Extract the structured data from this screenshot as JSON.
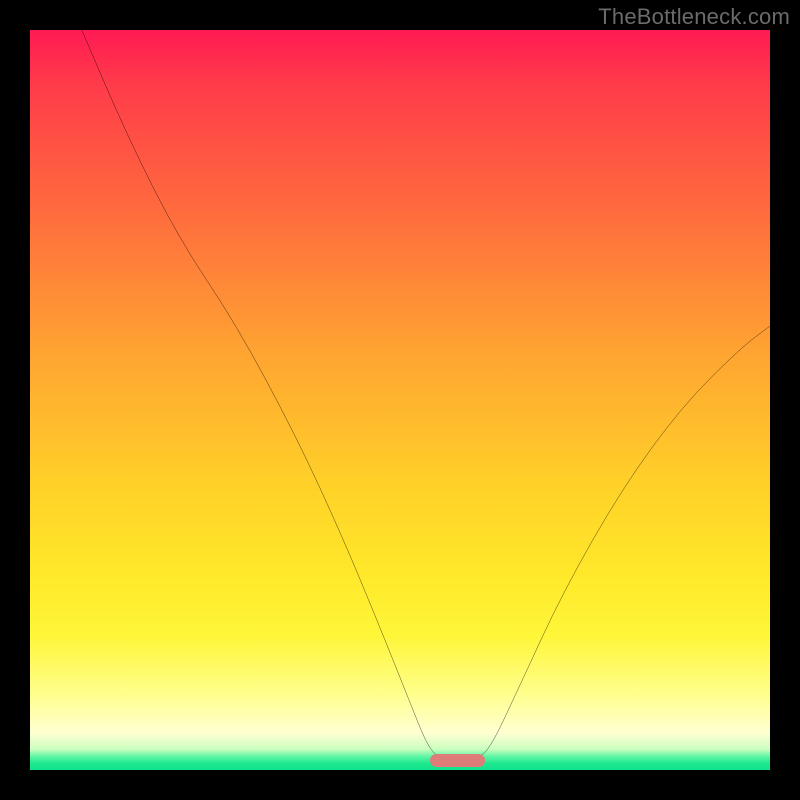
{
  "watermark": "TheBottleneck.com",
  "chart_data": {
    "type": "line",
    "title": "",
    "xlabel": "",
    "ylabel": "",
    "xlim": [
      0,
      100
    ],
    "ylim": [
      0,
      100
    ],
    "grid": false,
    "legend": false,
    "curve_points": [
      {
        "x": 7,
        "y": 100
      },
      {
        "x": 13,
        "y": 86
      },
      {
        "x": 20,
        "y": 72
      },
      {
        "x": 28,
        "y": 60
      },
      {
        "x": 36,
        "y": 45
      },
      {
        "x": 42,
        "y": 32
      },
      {
        "x": 47,
        "y": 20
      },
      {
        "x": 51,
        "y": 10
      },
      {
        "x": 54,
        "y": 2.5
      },
      {
        "x": 56,
        "y": 1.5
      },
      {
        "x": 60,
        "y": 1.5
      },
      {
        "x": 62,
        "y": 2.5
      },
      {
        "x": 66,
        "y": 11
      },
      {
        "x": 72,
        "y": 24
      },
      {
        "x": 80,
        "y": 38
      },
      {
        "x": 88,
        "y": 49
      },
      {
        "x": 96,
        "y": 57
      },
      {
        "x": 100,
        "y": 60
      }
    ],
    "marker": {
      "x_start": 54,
      "x_end": 61.5,
      "y": 1.2
    },
    "colors": {
      "curve": "#000000",
      "marker": "#de7c79",
      "gradient_top": "#ff1a53",
      "gradient_bottom": "#10e28c"
    }
  }
}
